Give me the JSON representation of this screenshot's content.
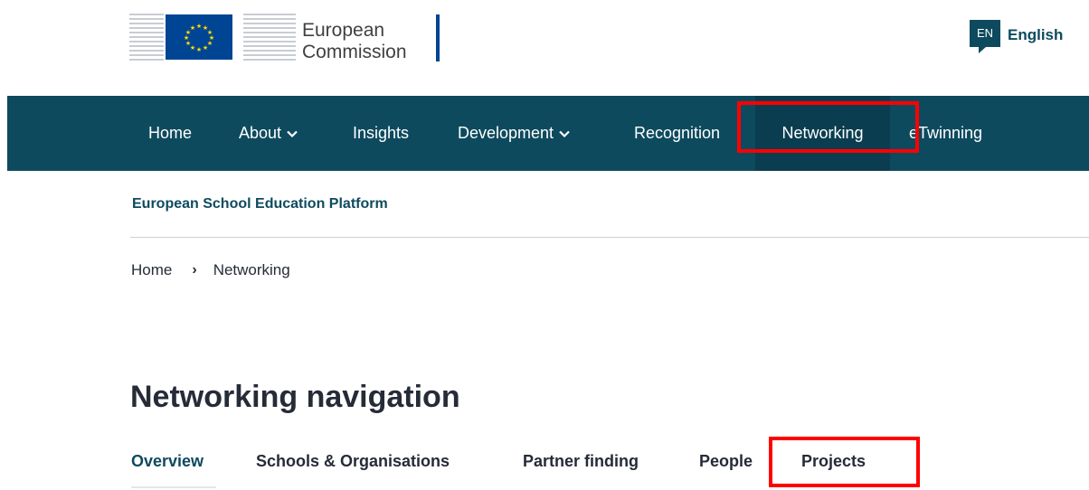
{
  "header": {
    "logo_line1": "European",
    "logo_line2": "Commission",
    "language_code": "EN",
    "language_label": "English"
  },
  "nav": {
    "items": [
      {
        "label": "Home",
        "has_dropdown": false
      },
      {
        "label": "About",
        "has_dropdown": true
      },
      {
        "label": "Insights",
        "has_dropdown": false
      },
      {
        "label": "Development",
        "has_dropdown": true
      },
      {
        "label": "Recognition",
        "has_dropdown": false
      },
      {
        "label": "Networking",
        "has_dropdown": false,
        "active": true
      },
      {
        "label": "eTwinning",
        "has_dropdown": false
      }
    ],
    "chevron": "⌄"
  },
  "site_name": "European School Education Platform",
  "breadcrumb": {
    "home": "Home",
    "separator": "›",
    "current": "Networking"
  },
  "page_title": "Networking navigation",
  "tabs": [
    {
      "label": "Overview",
      "active": true
    },
    {
      "label": "Schools & Organisations"
    },
    {
      "label": "Partner finding"
    },
    {
      "label": "People"
    },
    {
      "label": "Projects"
    }
  ],
  "colors": {
    "nav_background": "#0e4a5e",
    "highlight": "#ff0000",
    "eu_blue": "#004494",
    "eu_star": "#ffdd00"
  }
}
